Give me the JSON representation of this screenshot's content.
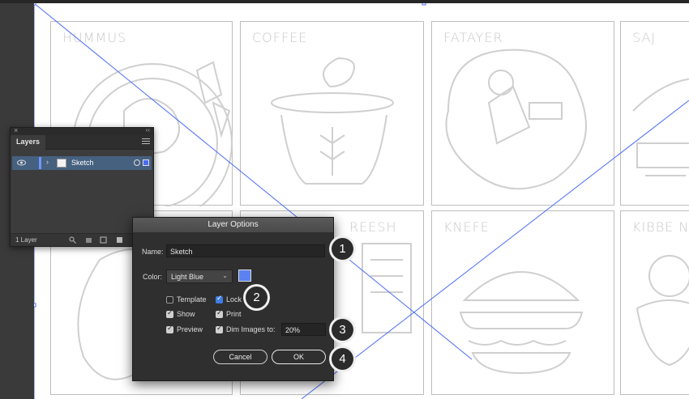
{
  "artboard": {
    "tiles": [
      {
        "label": "HUMMUS"
      },
      {
        "label": "COFFEE"
      },
      {
        "label": "FATAYER"
      },
      {
        "label": "SAJ"
      },
      {
        "label": ""
      },
      {
        "label": "REESH"
      },
      {
        "label": "KNEFE"
      },
      {
        "label": "KIBBE N"
      }
    ]
  },
  "layers_panel": {
    "close_glyph": "×",
    "collapse_glyph": "‹‹",
    "tab_label": "Layers",
    "layer": {
      "name": "Sketch",
      "visibility_icon": "eye-icon",
      "expand_icon": "chevron-right-icon",
      "color": "#6f97ff"
    },
    "footer_count": "1 Layer",
    "footer_icons": [
      "search-icon",
      "clip-icon",
      "new-sublayer-icon",
      "new-layer-icon"
    ]
  },
  "dialog": {
    "title": "Layer Options",
    "name_label": "Name:",
    "name_value": "Sketch",
    "color_label": "Color:",
    "color_value": "Light Blue",
    "swatch_color": "#5b82f0",
    "options": {
      "template": {
        "label": "Template",
        "checked": false
      },
      "lock": {
        "label": "Lock",
        "checked": true
      },
      "show": {
        "label": "Show",
        "checked": true
      },
      "print": {
        "label": "Print",
        "checked": true
      },
      "preview": {
        "label": "Preview",
        "checked": true
      },
      "dim_images": {
        "label": "Dim Images to:",
        "checked": true,
        "value": "20%"
      }
    },
    "cancel_label": "Cancel",
    "ok_label": "OK"
  },
  "callouts": [
    "1",
    "2",
    "3",
    "4"
  ],
  "colors": {
    "guide": "#4a6cf7",
    "sketch": "#cfcfcf"
  }
}
